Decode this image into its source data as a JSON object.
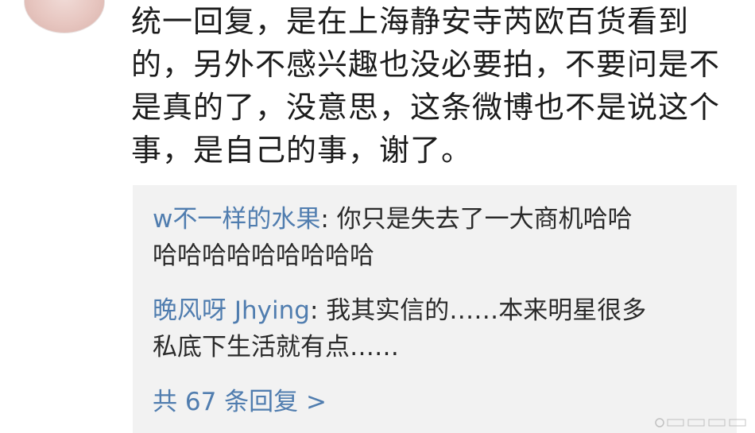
{
  "comment": {
    "lines": [
      "统一回复，是在上海静安寺芮欧百货看到",
      "的，另外不感兴趣也没必要拍，不要问是不",
      "是真的了，没意思，这条微博也不是说这个",
      "事，是自己的事，谢了。"
    ]
  },
  "replies": [
    {
      "user": "w不一样的水果",
      "separator": ": ",
      "first_line": "你只是失去了一大商机哈哈",
      "second_line": "哈哈哈哈哈哈哈哈哈"
    },
    {
      "user": "晚风呀 Jhying",
      "separator": ": ",
      "first_line": "我其实信的……本来明星很多",
      "second_line": "私底下生活就有点……"
    }
  ],
  "more_replies": "共 67 条回复 >"
}
